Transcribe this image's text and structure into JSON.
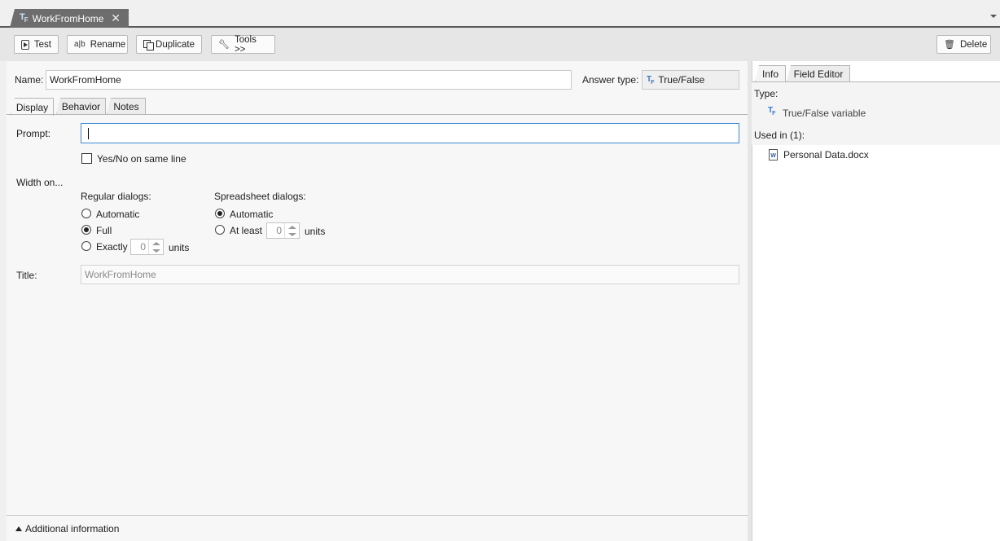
{
  "document_tab": {
    "title": "WorkFromHome",
    "icon": "true-false-variable-icon"
  },
  "toolbar": {
    "test_label": "Test",
    "rename_label": "Rename",
    "duplicate_label": "Duplicate",
    "tools_label": "Tools >>",
    "delete_label": "Delete"
  },
  "variable": {
    "name_label": "Name:",
    "name_value": "WorkFromHome",
    "answer_type_label": "Answer type:",
    "answer_type_value": "True/False"
  },
  "subtabs": [
    "Display",
    "Behavior",
    "Notes"
  ],
  "display": {
    "prompt_label": "Prompt:",
    "prompt_value": "",
    "yes_no_label": "Yes/No on same line",
    "yes_no_checked": false,
    "width_on_label": "Width on...",
    "regular": {
      "heading": "Regular dialogs:",
      "options": [
        "Automatic",
        "Full",
        "Exactly"
      ],
      "selected": "Full",
      "exactly_value": "0",
      "units_label": "units"
    },
    "spreadsheet": {
      "heading": "Spreadsheet dialogs:",
      "options": [
        "Automatic",
        "At least"
      ],
      "selected": "Automatic",
      "at_least_value": "0",
      "units_label": "units"
    },
    "title_label": "Title:",
    "title_placeholder": "WorkFromHome"
  },
  "footer": {
    "additional_info_label": "Additional information"
  },
  "right_panel": {
    "tabs": [
      "Info",
      "Field Editor"
    ],
    "type_label": "Type:",
    "type_value": "True/False variable",
    "used_in_label": "Used in (1):",
    "used_in_items": [
      "Personal Data.docx"
    ]
  }
}
